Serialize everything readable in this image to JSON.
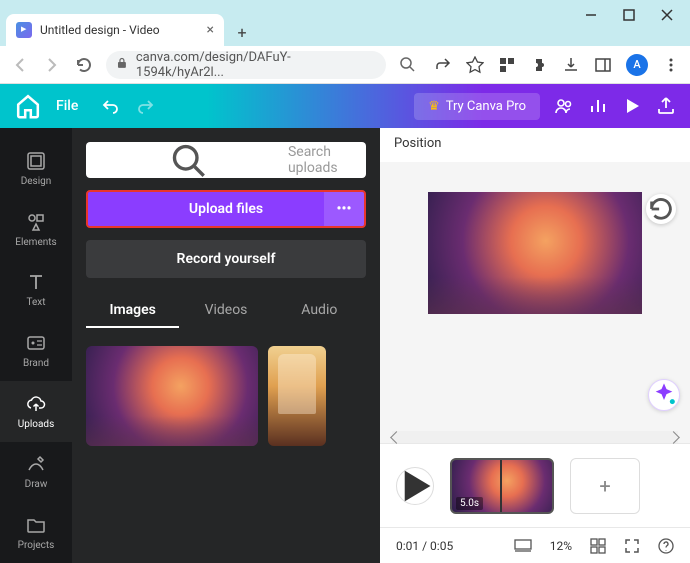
{
  "window": {
    "tab_title": "Untitled design - Video",
    "url": "canva.com/design/DAFuY-1594k/hyAr2l...",
    "avatar_letter": "A"
  },
  "appbar": {
    "file": "File",
    "try_pro": "Try Canva Pro"
  },
  "sidebar": {
    "items": [
      {
        "label": "Design"
      },
      {
        "label": "Elements"
      },
      {
        "label": "Text"
      },
      {
        "label": "Brand"
      },
      {
        "label": "Uploads"
      },
      {
        "label": "Draw"
      },
      {
        "label": "Projects"
      }
    ]
  },
  "panel": {
    "search_placeholder": "Search uploads",
    "upload_label": "Upload files",
    "record_label": "Record yourself",
    "tabs": [
      {
        "label": "Images"
      },
      {
        "label": "Videos"
      },
      {
        "label": "Audio"
      }
    ]
  },
  "canvas": {
    "position_label": "Position"
  },
  "timeline": {
    "clip_duration": "5.0s"
  },
  "statusbar": {
    "time": "0:01 / 0:05",
    "zoom": "12%"
  }
}
